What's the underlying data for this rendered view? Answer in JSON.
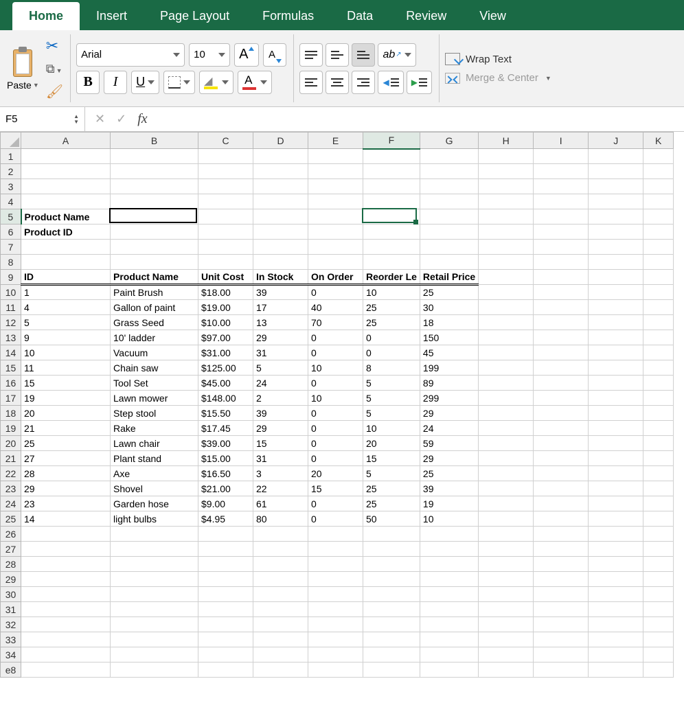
{
  "tabs": [
    "Home",
    "Insert",
    "Page Layout",
    "Formulas",
    "Data",
    "Review",
    "View"
  ],
  "active_tab": 0,
  "ribbon": {
    "paste_label": "Paste",
    "font_name": "Arial",
    "font_size": "10",
    "bold": "B",
    "italic": "I",
    "underline": "U",
    "grow_A": "A",
    "shrink_A": "A",
    "fontclr_A": "A",
    "orient_ab": "ab",
    "wrap_text": "Wrap Text",
    "merge_center": "Merge & Center"
  },
  "namebox": "F5",
  "fx_cancel": "✕",
  "fx_enter": "✓",
  "fx_label": "fx",
  "formula_value": "",
  "columns": [
    "A",
    "B",
    "C",
    "D",
    "E",
    "F",
    "G",
    "H",
    "I",
    "J",
    "K"
  ],
  "row_numbers": [
    1,
    2,
    3,
    4,
    5,
    6,
    7,
    8,
    9,
    10,
    11,
    12,
    13,
    14,
    15,
    16,
    17,
    18,
    19,
    20,
    21,
    22,
    23,
    24,
    25,
    26,
    27,
    28,
    29,
    30,
    31,
    32,
    33,
    34,
    "e8"
  ],
  "selected_col_index": 5,
  "selected_row_num": 5,
  "labels": {
    "product_name": "Product Name",
    "product_id": "Product ID"
  },
  "headers": [
    "ID",
    "Product Name",
    "Unit Cost",
    "In Stock",
    "On Order",
    "Reorder Le",
    "Retail Price"
  ],
  "rows": [
    {
      "id": 1,
      "name": "Paint Brush",
      "cost": "$18.00",
      "stock": 39,
      "order": 0,
      "reorder": 10,
      "retail": 25
    },
    {
      "id": 4,
      "name": "Gallon of paint",
      "cost": "$19.00",
      "stock": 17,
      "order": 40,
      "reorder": 25,
      "retail": 30
    },
    {
      "id": 5,
      "name": "Grass Seed",
      "cost": "$10.00",
      "stock": 13,
      "order": 70,
      "reorder": 25,
      "retail": 18
    },
    {
      "id": 9,
      "name": "10' ladder",
      "cost": "$97.00",
      "stock": 29,
      "order": 0,
      "reorder": 0,
      "retail": 150
    },
    {
      "id": 10,
      "name": "Vacuum",
      "cost": "$31.00",
      "stock": 31,
      "order": 0,
      "reorder": 0,
      "retail": 45
    },
    {
      "id": 11,
      "name": "Chain saw",
      "cost": "$125.00",
      "stock": 5,
      "order": 10,
      "reorder": 8,
      "retail": 199
    },
    {
      "id": 15,
      "name": "Tool Set",
      "cost": "$45.00",
      "stock": 24,
      "order": 0,
      "reorder": 5,
      "retail": 89
    },
    {
      "id": 19,
      "name": "Lawn mower",
      "cost": "$148.00",
      "stock": 2,
      "order": 10,
      "reorder": 5,
      "retail": 299
    },
    {
      "id": 20,
      "name": "Step stool",
      "cost": "$15.50",
      "stock": 39,
      "order": 0,
      "reorder": 5,
      "retail": 29
    },
    {
      "id": 21,
      "name": "Rake",
      "cost": "$17.45",
      "stock": 29,
      "order": 0,
      "reorder": 10,
      "retail": 24
    },
    {
      "id": 25,
      "name": "Lawn chair",
      "cost": "$39.00",
      "stock": 15,
      "order": 0,
      "reorder": 20,
      "retail": 59
    },
    {
      "id": 27,
      "name": "Plant stand",
      "cost": "$15.00",
      "stock": 31,
      "order": 0,
      "reorder": 15,
      "retail": 29
    },
    {
      "id": 28,
      "name": "Axe",
      "cost": "$16.50",
      "stock": 3,
      "order": 20,
      "reorder": 5,
      "retail": 25
    },
    {
      "id": 29,
      "name": "Shovel",
      "cost": "$21.00",
      "stock": 22,
      "order": 15,
      "reorder": 25,
      "retail": 39
    },
    {
      "id": 23,
      "name": "Garden hose",
      "cost": "$9.00",
      "stock": 61,
      "order": 0,
      "reorder": 25,
      "retail": 19
    },
    {
      "id": 14,
      "name": "light bulbs",
      "cost": "$4.95",
      "stock": 80,
      "order": 0,
      "reorder": 50,
      "retail": 10
    }
  ]
}
